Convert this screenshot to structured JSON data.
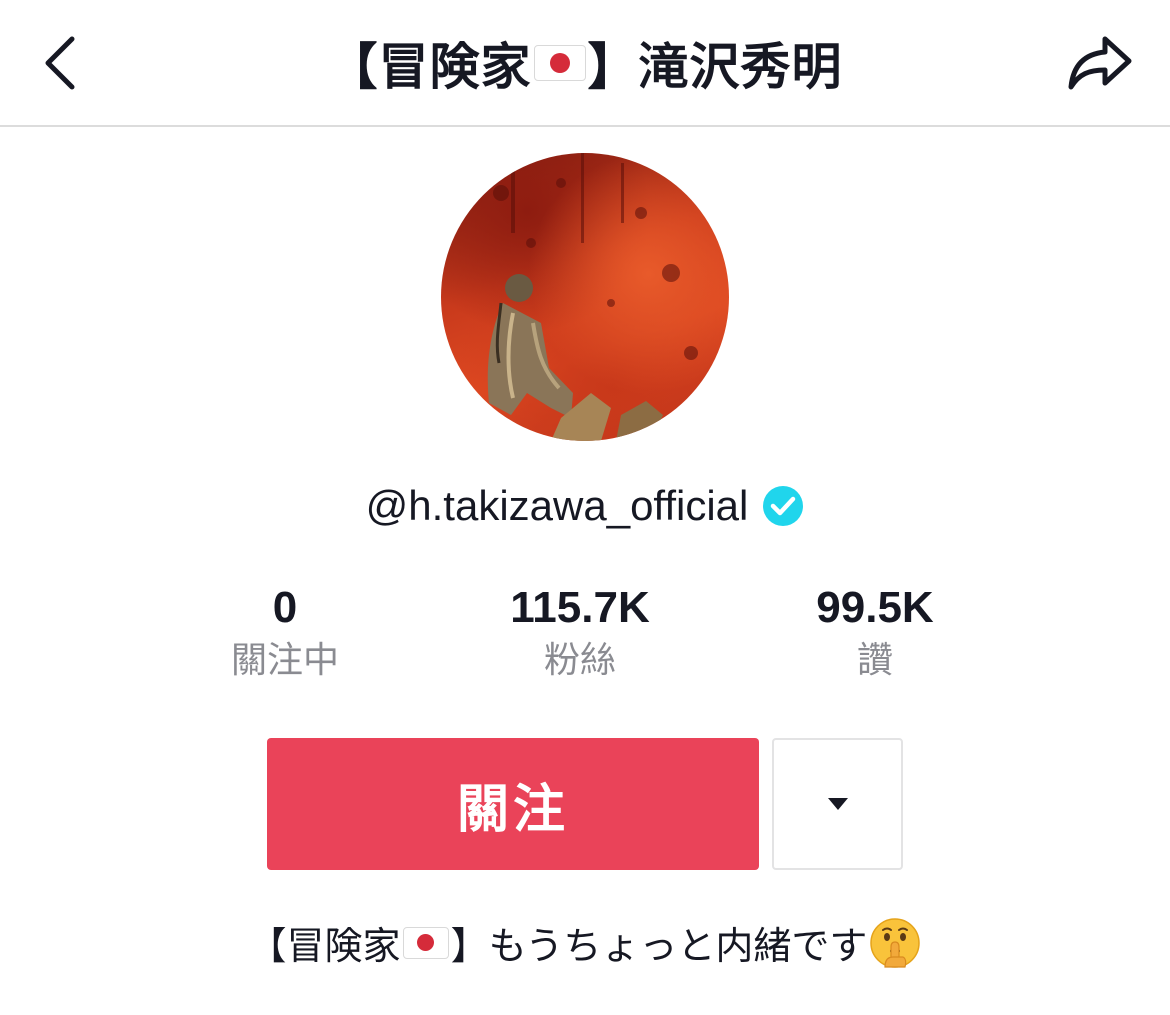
{
  "header": {
    "title_left": "【冒険家",
    "title_right": "】滝沢秀明",
    "back_icon": "chevron-left-icon",
    "share_icon": "share-arrow-icon"
  },
  "profile": {
    "avatar_alt": "avatar",
    "username": "@h.takizawa_official",
    "verified": true
  },
  "stats": [
    {
      "value": "0",
      "label": "關注中"
    },
    {
      "value": "115.7K",
      "label": "粉絲"
    },
    {
      "value": "99.5K",
      "label": "讚"
    }
  ],
  "actions": {
    "follow_label": "關注",
    "dropdown_icon": "caret-down-icon"
  },
  "bio": {
    "prefix": "【冒険家",
    "suffix": "】もうちょっと内緒です",
    "emoji": "shushing-face-icon"
  },
  "colors": {
    "accent": "#ea4359",
    "text": "#161823",
    "muted": "#8a8b91",
    "verified": "#20d5ec",
    "divider": "#dcdcdc"
  }
}
